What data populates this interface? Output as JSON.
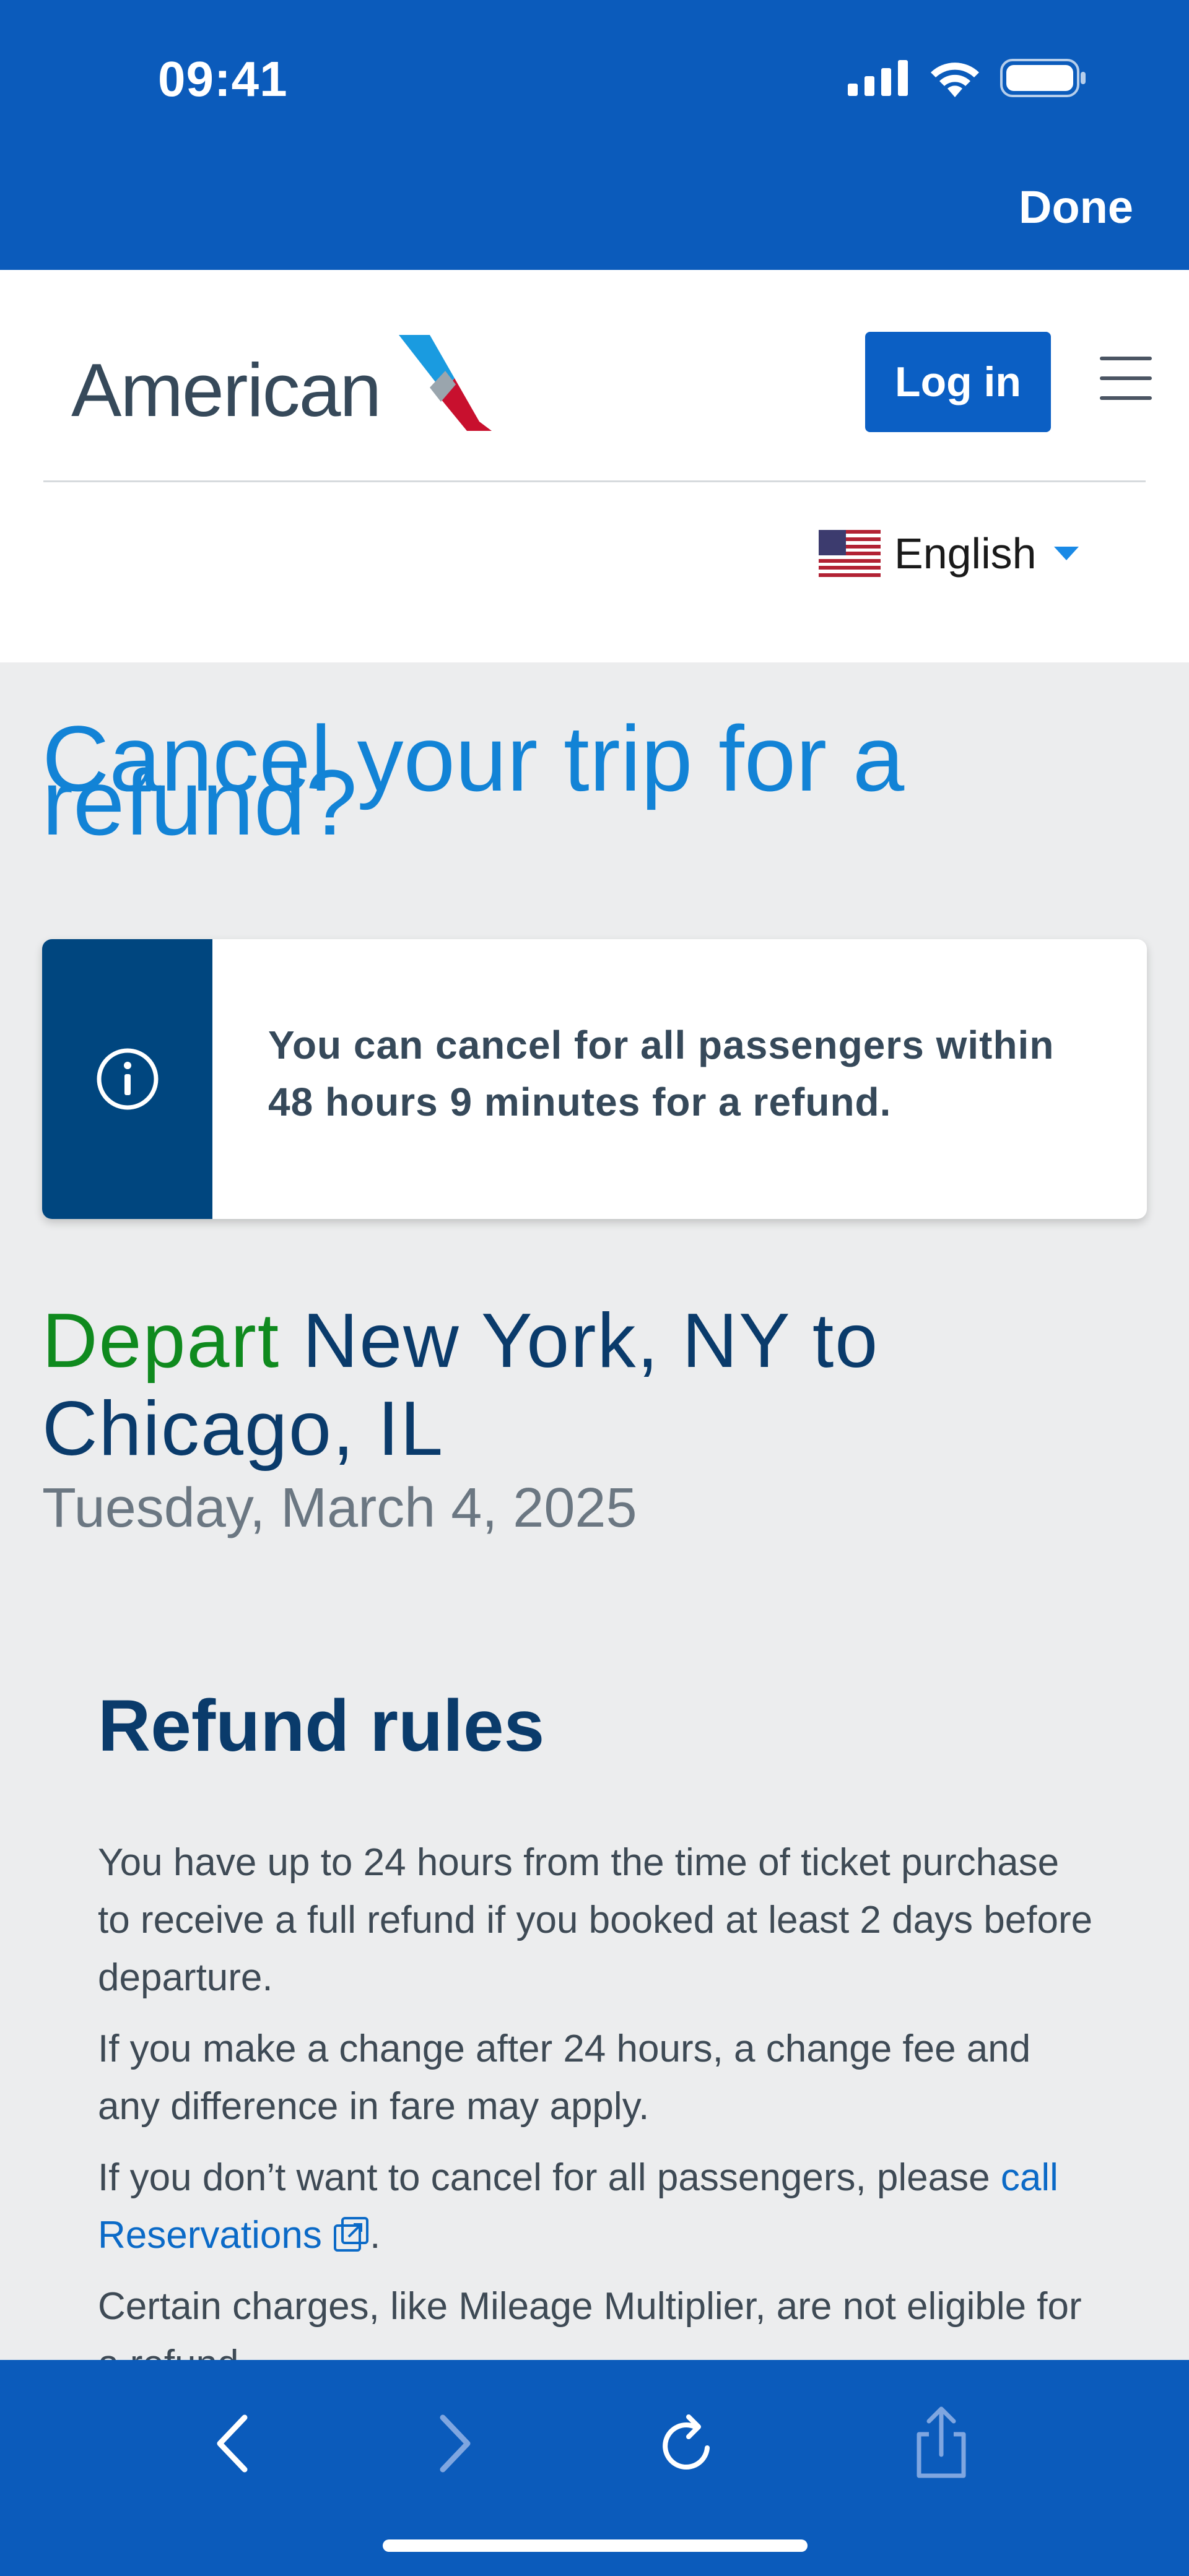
{
  "status_bar": {
    "time": "09:41"
  },
  "top_bar": {
    "done_label": "Done"
  },
  "header": {
    "logo_text": "American",
    "login_label": "Log in",
    "language_label": "English"
  },
  "main": {
    "title": "Cancel your trip for a refund?",
    "info_message": "You can cancel for all passengers within 48 hours 9 minutes for a refund.",
    "route": {
      "depart_word": "Depart",
      "route_text": " New York, NY to Chicago, IL"
    },
    "date": "Tuesday, March 4, 2025",
    "refund_rules": {
      "title": "Refund rules",
      "para1": "You have up to 24 hours from the time of ticket purchase to receive a full refund if you booked at least 2 days before departure.",
      "para2": "If you make a change after 24 hours, a change fee and any difference in fare may apply.",
      "para3_prefix": "If you don’t want to cancel for all passengers, please ",
      "para3_link": "call Reservations",
      "para3_suffix": ".",
      "para4": "Certain charges, like Mileage Multiplier, are not eligible for a refund."
    }
  },
  "colors": {
    "brand_blue": "#0b5bbb",
    "title_blue": "#1283d6",
    "navy": "#0a3b6b",
    "depart_green": "#0f8a1e",
    "info_side": "#00467f"
  },
  "icons": [
    "cellular-signal-icon",
    "wifi-icon",
    "battery-icon",
    "info-icon",
    "us-flag-icon",
    "back-arrow-icon",
    "forward-arrow-icon",
    "reload-icon",
    "share-icon",
    "menu-icon"
  ]
}
